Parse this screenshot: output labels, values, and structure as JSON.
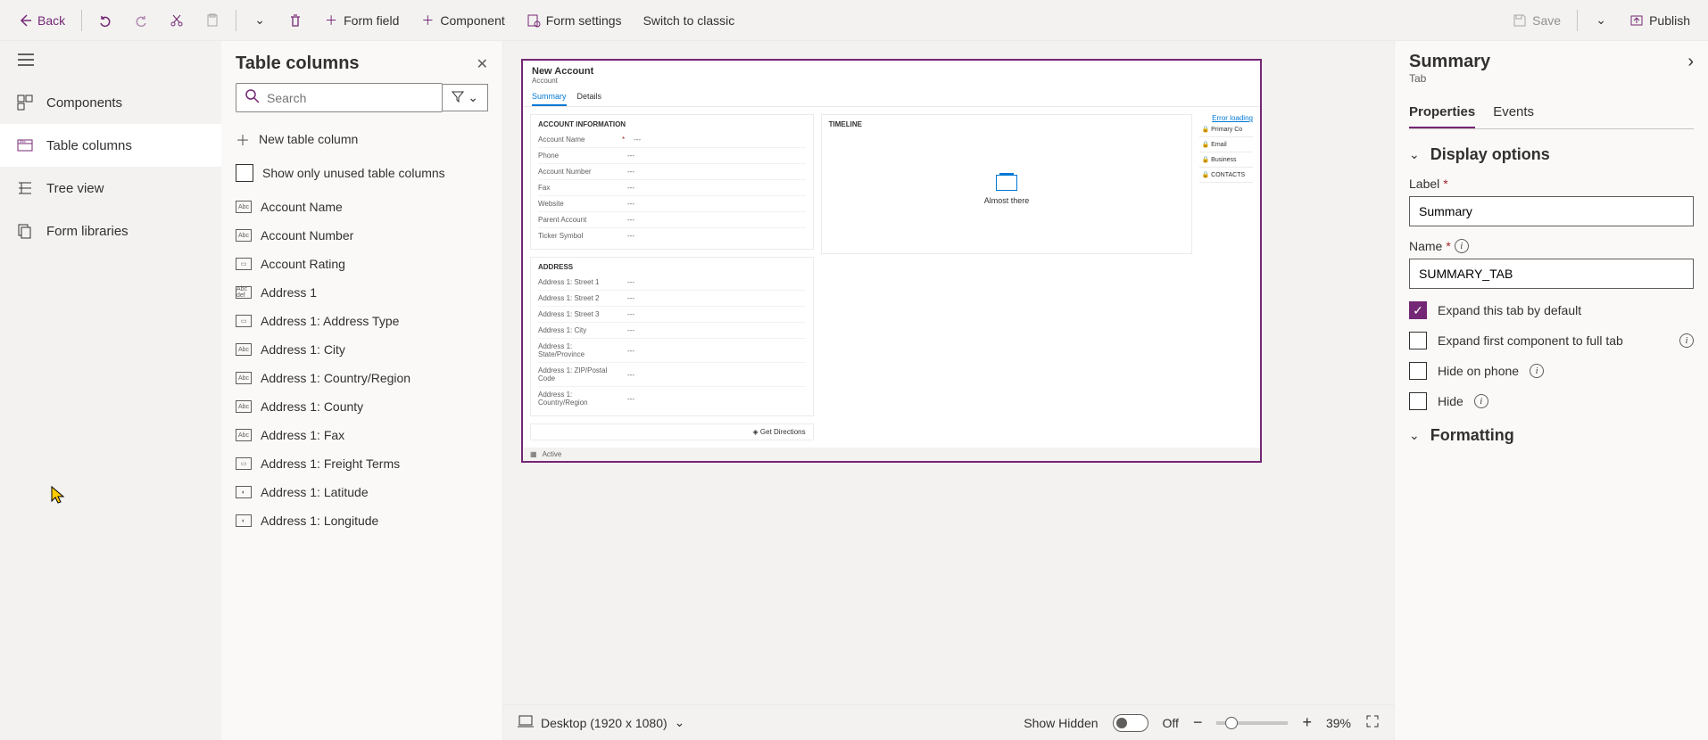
{
  "topbar": {
    "back": "Back",
    "form_field": "Form field",
    "component": "Component",
    "form_settings": "Form settings",
    "switch_classic": "Switch to classic",
    "save": "Save",
    "publish": "Publish"
  },
  "sidenav": {
    "components": "Components",
    "table_columns": "Table columns",
    "tree_view": "Tree view",
    "form_libraries": "Form libraries"
  },
  "columns_panel": {
    "title": "Table columns",
    "search_placeholder": "Search",
    "new_column": "New table column",
    "show_unused": "Show only unused table columns",
    "items": [
      {
        "label": "Account Name",
        "t": "Abc"
      },
      {
        "label": "Account Number",
        "t": "Abc"
      },
      {
        "label": "Account Rating",
        "t": "▭"
      },
      {
        "label": "Address 1",
        "t": "Abc\ndef"
      },
      {
        "label": "Address 1: Address Type",
        "t": "▭"
      },
      {
        "label": "Address 1: City",
        "t": "Abc"
      },
      {
        "label": "Address 1: Country/Region",
        "t": "Abc"
      },
      {
        "label": "Address 1: County",
        "t": "Abc"
      },
      {
        "label": "Address 1: Fax",
        "t": "Abc"
      },
      {
        "label": "Address 1: Freight Terms",
        "t": "▭"
      },
      {
        "label": "Address 1: Latitude",
        "t": "◐"
      },
      {
        "label": "Address 1: Longitude",
        "t": "◐"
      }
    ]
  },
  "form_preview": {
    "title": "New Account",
    "subtitle": "Account",
    "tabs": [
      "Summary",
      "Details"
    ],
    "active_tab": 0,
    "sections": {
      "account_info": {
        "title": "ACCOUNT INFORMATION",
        "fields": [
          {
            "label": "Account Name",
            "req": true,
            "val": "---"
          },
          {
            "label": "Phone",
            "req": false,
            "val": "---"
          },
          {
            "label": "Account Number",
            "req": false,
            "val": "---"
          },
          {
            "label": "Fax",
            "req": false,
            "val": "---"
          },
          {
            "label": "Website",
            "req": false,
            "val": "---"
          },
          {
            "label": "Parent Account",
            "req": false,
            "val": "---"
          },
          {
            "label": "Ticker Symbol",
            "req": false,
            "val": "---"
          }
        ]
      },
      "address": {
        "title": "ADDRESS",
        "fields": [
          {
            "label": "Address 1: Street 1",
            "val": "---"
          },
          {
            "label": "Address 1: Street 2",
            "val": "---"
          },
          {
            "label": "Address 1: Street 3",
            "val": "---"
          },
          {
            "label": "Address 1: City",
            "val": "---"
          },
          {
            "label": "Address 1: State/Province",
            "val": "---"
          },
          {
            "label": "Address 1: ZIP/Postal Code",
            "val": "---"
          },
          {
            "label": "Address 1: Country/Region",
            "val": "---"
          }
        ]
      },
      "timeline": {
        "title": "Timeline",
        "msg": "Almost there"
      },
      "get_directions": "Get Directions",
      "error_loading": "Error loading",
      "side_items": [
        "Primary Co",
        "Email",
        "Business",
        "CONTACTS"
      ],
      "footer_status": "Active"
    }
  },
  "canvas_status": {
    "device": "Desktop (1920 x 1080)",
    "show_hidden": "Show Hidden",
    "toggle": "Off",
    "zoom": "39%"
  },
  "props": {
    "title": "Summary",
    "subtitle": "Tab",
    "tabs": [
      "Properties",
      "Events"
    ],
    "active_tab": 0,
    "display_options": "Display options",
    "label_label": "Label",
    "label_value": "Summary",
    "name_label": "Name",
    "name_value": "SUMMARY_TAB",
    "expand_default": "Expand this tab by default",
    "expand_first": "Expand first component to full tab",
    "hide_phone": "Hide on phone",
    "hide": "Hide",
    "formatting": "Formatting"
  }
}
